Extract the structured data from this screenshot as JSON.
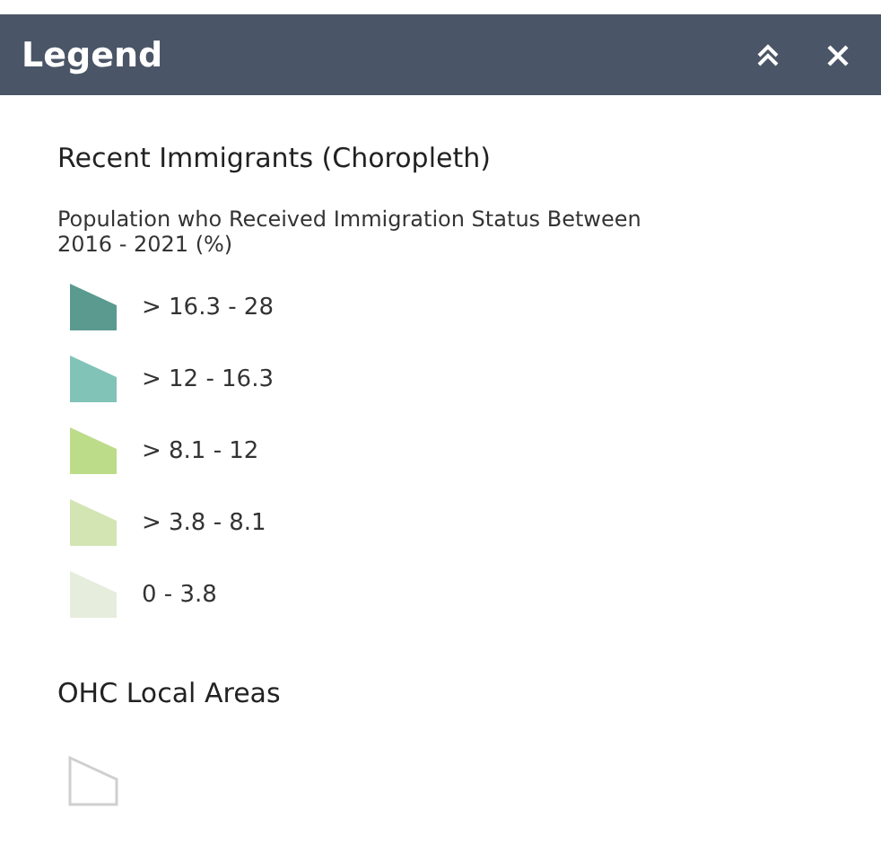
{
  "panel": {
    "title": "Legend",
    "buttons": [
      {
        "kind": "collapse"
      },
      {
        "kind": "close"
      }
    ]
  },
  "layers": [
    {
      "title": "Recent Immigrants (Choropleth)",
      "description": "Population who Received Immigration Status Between 2016 - 2021 (%)",
      "items": [
        {
          "kind": "fill",
          "label": "> 16.3 - 28",
          "color": "#5a9a8f"
        },
        {
          "kind": "fill",
          "label": "> 12 - 16.3",
          "color": "#82c3b8"
        },
        {
          "kind": "fill",
          "label": "> 8.1 - 12",
          "color": "#bcdc8a"
        },
        {
          "kind": "fill",
          "label": "> 3.8 - 8.1",
          "color": "#d3e5b3"
        },
        {
          "kind": "fill",
          "label": "0 - 3.8",
          "color": "#e6eddc"
        }
      ]
    },
    {
      "title": "OHC Local Areas",
      "items": [
        {
          "kind": "outline"
        }
      ]
    }
  ]
}
